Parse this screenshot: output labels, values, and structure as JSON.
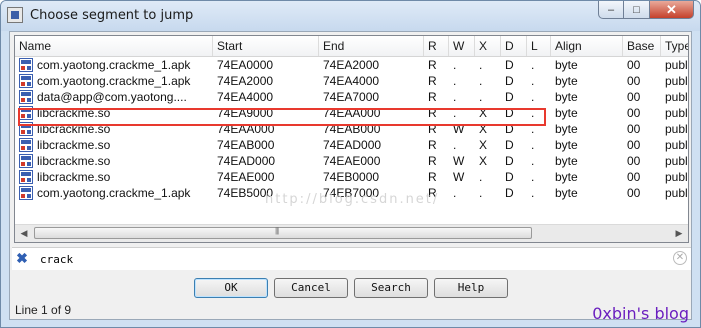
{
  "window": {
    "title": "Choose segment to jump"
  },
  "columns": [
    "Name",
    "Start",
    "End",
    "R",
    "W",
    "X",
    "D",
    "L",
    "Align",
    "Base",
    "Type"
  ],
  "segments": [
    {
      "name": "com.yaotong.crackme_1.apk",
      "start": "74EA0000",
      "end": "74EA2000",
      "r": "R",
      "w": ".",
      "x": ".",
      "d": "D",
      "l": ".",
      "align": "byte",
      "base": "00",
      "type": "public"
    },
    {
      "name": "com.yaotong.crackme_1.apk",
      "start": "74EA2000",
      "end": "74EA4000",
      "r": "R",
      "w": ".",
      "x": ".",
      "d": "D",
      "l": ".",
      "align": "byte",
      "base": "00",
      "type": "public"
    },
    {
      "name": "data@app@com.yaotong....",
      "start": "74EA4000",
      "end": "74EA7000",
      "r": "R",
      "w": ".",
      "x": ".",
      "d": "D",
      "l": ".",
      "align": "byte",
      "base": "00",
      "type": "public"
    },
    {
      "name": "libcrackme.so",
      "start": "74EA9000",
      "end": "74EAA000",
      "r": "R",
      "w": ".",
      "x": "X",
      "d": "D",
      "l": ".",
      "align": "byte",
      "base": "00",
      "type": "public"
    },
    {
      "name": "libcrackme.so",
      "start": "74EAA000",
      "end": "74EAB000",
      "r": "R",
      "w": "W",
      "x": "X",
      "d": "D",
      "l": ".",
      "align": "byte",
      "base": "00",
      "type": "public"
    },
    {
      "name": "libcrackme.so",
      "start": "74EAB000",
      "end": "74EAD000",
      "r": "R",
      "w": ".",
      "x": "X",
      "d": "D",
      "l": ".",
      "align": "byte",
      "base": "00",
      "type": "public"
    },
    {
      "name": "libcrackme.so",
      "start": "74EAD000",
      "end": "74EAE000",
      "r": "R",
      "w": "W",
      "x": "X",
      "d": "D",
      "l": ".",
      "align": "byte",
      "base": "00",
      "type": "public"
    },
    {
      "name": "libcrackme.so",
      "start": "74EAE000",
      "end": "74EB0000",
      "r": "R",
      "w": "W",
      "x": ".",
      "d": "D",
      "l": ".",
      "align": "byte",
      "base": "00",
      "type": "public"
    },
    {
      "name": "com.yaotong.crackme_1.apk",
      "start": "74EB5000",
      "end": "74EB7000",
      "r": "R",
      "w": ".",
      "x": ".",
      "d": "D",
      "l": ".",
      "align": "byte",
      "base": "00",
      "type": "public"
    }
  ],
  "filter": {
    "value": "crack"
  },
  "buttons": {
    "ok": "OK",
    "cancel": "Cancel",
    "search": "Search",
    "help": "Help"
  },
  "status": "Line 1 of 9",
  "brand": "0xbin's blog",
  "watermark": "http://blog.csdn.net/",
  "colors": {
    "highlight": "#e8392e",
    "brand": "#6a1fbf",
    "filter_icon": "#2f5fb3"
  },
  "icons": {
    "row": "segment-icon",
    "filter": "filter-close-icon",
    "clear": "clear-icon"
  }
}
